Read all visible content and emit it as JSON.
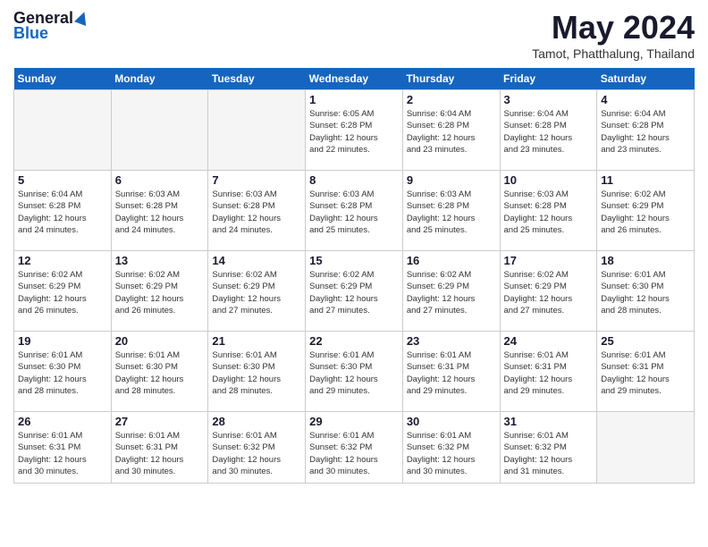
{
  "logo": {
    "general": "General",
    "blue": "Blue"
  },
  "title": "May 2024",
  "location": "Tamot, Phatthalung, Thailand",
  "headers": [
    "Sunday",
    "Monday",
    "Tuesday",
    "Wednesday",
    "Thursday",
    "Friday",
    "Saturday"
  ],
  "weeks": [
    [
      {
        "day": "",
        "info": ""
      },
      {
        "day": "",
        "info": ""
      },
      {
        "day": "",
        "info": ""
      },
      {
        "day": "1",
        "info": "Sunrise: 6:05 AM\nSunset: 6:28 PM\nDaylight: 12 hours\nand 22 minutes."
      },
      {
        "day": "2",
        "info": "Sunrise: 6:04 AM\nSunset: 6:28 PM\nDaylight: 12 hours\nand 23 minutes."
      },
      {
        "day": "3",
        "info": "Sunrise: 6:04 AM\nSunset: 6:28 PM\nDaylight: 12 hours\nand 23 minutes."
      },
      {
        "day": "4",
        "info": "Sunrise: 6:04 AM\nSunset: 6:28 PM\nDaylight: 12 hours\nand 23 minutes."
      }
    ],
    [
      {
        "day": "5",
        "info": "Sunrise: 6:04 AM\nSunset: 6:28 PM\nDaylight: 12 hours\nand 24 minutes."
      },
      {
        "day": "6",
        "info": "Sunrise: 6:03 AM\nSunset: 6:28 PM\nDaylight: 12 hours\nand 24 minutes."
      },
      {
        "day": "7",
        "info": "Sunrise: 6:03 AM\nSunset: 6:28 PM\nDaylight: 12 hours\nand 24 minutes."
      },
      {
        "day": "8",
        "info": "Sunrise: 6:03 AM\nSunset: 6:28 PM\nDaylight: 12 hours\nand 25 minutes."
      },
      {
        "day": "9",
        "info": "Sunrise: 6:03 AM\nSunset: 6:28 PM\nDaylight: 12 hours\nand 25 minutes."
      },
      {
        "day": "10",
        "info": "Sunrise: 6:03 AM\nSunset: 6:28 PM\nDaylight: 12 hours\nand 25 minutes."
      },
      {
        "day": "11",
        "info": "Sunrise: 6:02 AM\nSunset: 6:29 PM\nDaylight: 12 hours\nand 26 minutes."
      }
    ],
    [
      {
        "day": "12",
        "info": "Sunrise: 6:02 AM\nSunset: 6:29 PM\nDaylight: 12 hours\nand 26 minutes."
      },
      {
        "day": "13",
        "info": "Sunrise: 6:02 AM\nSunset: 6:29 PM\nDaylight: 12 hours\nand 26 minutes."
      },
      {
        "day": "14",
        "info": "Sunrise: 6:02 AM\nSunset: 6:29 PM\nDaylight: 12 hours\nand 27 minutes."
      },
      {
        "day": "15",
        "info": "Sunrise: 6:02 AM\nSunset: 6:29 PM\nDaylight: 12 hours\nand 27 minutes."
      },
      {
        "day": "16",
        "info": "Sunrise: 6:02 AM\nSunset: 6:29 PM\nDaylight: 12 hours\nand 27 minutes."
      },
      {
        "day": "17",
        "info": "Sunrise: 6:02 AM\nSunset: 6:29 PM\nDaylight: 12 hours\nand 27 minutes."
      },
      {
        "day": "18",
        "info": "Sunrise: 6:01 AM\nSunset: 6:30 PM\nDaylight: 12 hours\nand 28 minutes."
      }
    ],
    [
      {
        "day": "19",
        "info": "Sunrise: 6:01 AM\nSunset: 6:30 PM\nDaylight: 12 hours\nand 28 minutes."
      },
      {
        "day": "20",
        "info": "Sunrise: 6:01 AM\nSunset: 6:30 PM\nDaylight: 12 hours\nand 28 minutes."
      },
      {
        "day": "21",
        "info": "Sunrise: 6:01 AM\nSunset: 6:30 PM\nDaylight: 12 hours\nand 28 minutes."
      },
      {
        "day": "22",
        "info": "Sunrise: 6:01 AM\nSunset: 6:30 PM\nDaylight: 12 hours\nand 29 minutes."
      },
      {
        "day": "23",
        "info": "Sunrise: 6:01 AM\nSunset: 6:31 PM\nDaylight: 12 hours\nand 29 minutes."
      },
      {
        "day": "24",
        "info": "Sunrise: 6:01 AM\nSunset: 6:31 PM\nDaylight: 12 hours\nand 29 minutes."
      },
      {
        "day": "25",
        "info": "Sunrise: 6:01 AM\nSunset: 6:31 PM\nDaylight: 12 hours\nand 29 minutes."
      }
    ],
    [
      {
        "day": "26",
        "info": "Sunrise: 6:01 AM\nSunset: 6:31 PM\nDaylight: 12 hours\nand 30 minutes."
      },
      {
        "day": "27",
        "info": "Sunrise: 6:01 AM\nSunset: 6:31 PM\nDaylight: 12 hours\nand 30 minutes."
      },
      {
        "day": "28",
        "info": "Sunrise: 6:01 AM\nSunset: 6:32 PM\nDaylight: 12 hours\nand 30 minutes."
      },
      {
        "day": "29",
        "info": "Sunrise: 6:01 AM\nSunset: 6:32 PM\nDaylight: 12 hours\nand 30 minutes."
      },
      {
        "day": "30",
        "info": "Sunrise: 6:01 AM\nSunset: 6:32 PM\nDaylight: 12 hours\nand 30 minutes."
      },
      {
        "day": "31",
        "info": "Sunrise: 6:01 AM\nSunset: 6:32 PM\nDaylight: 12 hours\nand 31 minutes."
      },
      {
        "day": "",
        "info": ""
      }
    ]
  ]
}
